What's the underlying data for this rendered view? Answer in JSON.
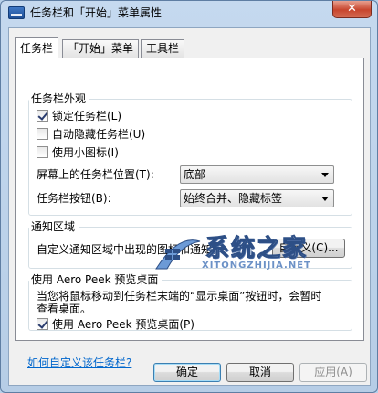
{
  "window": {
    "title": "任务栏和「开始」菜单属性",
    "close_label": "✕"
  },
  "tabs": [
    {
      "label": "任务栏",
      "active": true
    },
    {
      "label": "「开始」菜单",
      "active": false
    },
    {
      "label": "工具栏",
      "active": false
    }
  ],
  "appearance": {
    "title": "任务栏外观",
    "lock": {
      "label": "锁定任务栏(L)",
      "checked": true
    },
    "autohide": {
      "label": "自动隐藏任务栏(U)",
      "checked": false
    },
    "small_icons": {
      "label": "使用小图标(I)",
      "checked": false
    },
    "position": {
      "label": "屏幕上的任务栏位置(T):",
      "value": "底部"
    },
    "buttons": {
      "label": "任务栏按钮(B):",
      "value": "始终合并、隐藏标签"
    }
  },
  "notification": {
    "title": "通知区域",
    "description": "自定义通知区域中出现的图标和通知。",
    "customize_label": "自定义(C)..."
  },
  "aero_peek": {
    "title": "使用 Aero Peek 预览桌面",
    "description_line1": "当您将鼠标移动到任务栏末端的“显示桌面”按钮时，会暂时",
    "description_line2": "查看桌面。",
    "checkbox": {
      "label": "使用 Aero Peek 预览桌面(P)",
      "checked": true
    }
  },
  "help_link": "如何自定义该任务栏?",
  "footer": {
    "ok": "确定",
    "cancel": "取消",
    "apply": "应用(A)"
  },
  "watermark": {
    "text": "系统之家",
    "url": "XITONGZHIJIA.NET"
  }
}
